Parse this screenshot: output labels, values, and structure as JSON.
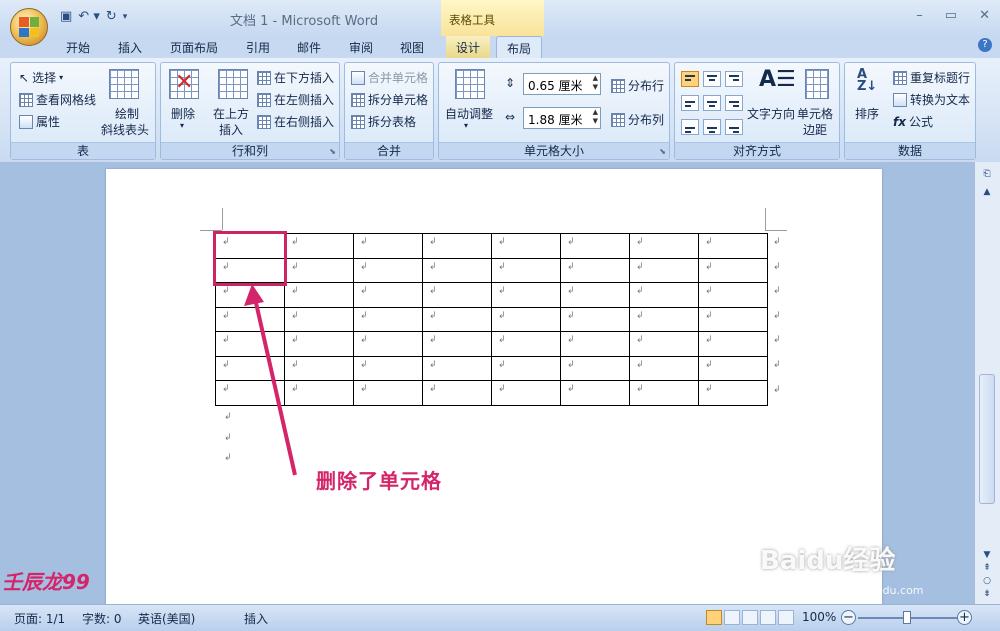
{
  "window": {
    "title": "文档 1 - Microsoft Word",
    "context_tab_group": "表格工具",
    "controls": [
      "–",
      "▭",
      "✕"
    ]
  },
  "quick_access": [
    "save-icon",
    "undo-icon",
    "redo-icon",
    "customize-icon"
  ],
  "tabs": [
    {
      "label": "开始"
    },
    {
      "label": "插入"
    },
    {
      "label": "页面布局"
    },
    {
      "label": "引用"
    },
    {
      "label": "邮件"
    },
    {
      "label": "审阅"
    },
    {
      "label": "视图"
    },
    {
      "label": "设计"
    },
    {
      "label": "布局"
    }
  ],
  "ribbon": {
    "table_group": {
      "label": "表",
      "select": "选择",
      "view_gridlines": "查看网格线",
      "properties": "属性",
      "draw_diagonal_1": "绘制",
      "draw_diagonal_2": "斜线表头"
    },
    "rows_cols_group": {
      "label": "行和列",
      "delete": "删除",
      "insert_above_1": "在上方",
      "insert_above_2": "插入",
      "insert_below": "在下方插入",
      "insert_left": "在左侧插入",
      "insert_right": "在右侧插入"
    },
    "merge_group": {
      "label": "合并",
      "merge_cells": "合并单元格",
      "split_cells": "拆分单元格",
      "split_table": "拆分表格"
    },
    "cell_size_group": {
      "label": "单元格大小",
      "autofit": "自动调整",
      "height_value": "0.65 厘米",
      "width_value": "1.88 厘米",
      "distribute_rows": "分布行",
      "distribute_cols": "分布列"
    },
    "alignment_group": {
      "label": "对齐方式",
      "text_direction": "文字方向",
      "cell_margins_1": "单元格",
      "cell_margins_2": "边距"
    },
    "data_group": {
      "label": "数据",
      "sort": "排序",
      "repeat_header": "重复标题行",
      "convert_to_text": "转换为文本",
      "formula": "公式"
    }
  },
  "document": {
    "rows": 7,
    "cols": 8,
    "cell_mark": "↲",
    "annotation": "删除了单元格"
  },
  "status": {
    "page": "页面: 1/1",
    "words": "字数: 0",
    "language": "英语(美国)",
    "mode": "插入",
    "zoom": "100%"
  },
  "watermark": "壬辰龙99",
  "site_watermark": "Baidu经验",
  "site_watermark_sub": "jingyan.baidu.com",
  "colors": {
    "highlight": "#cc2563",
    "ribbon_bg": "#dfeaf8",
    "context_tab": "#f8e39b"
  }
}
